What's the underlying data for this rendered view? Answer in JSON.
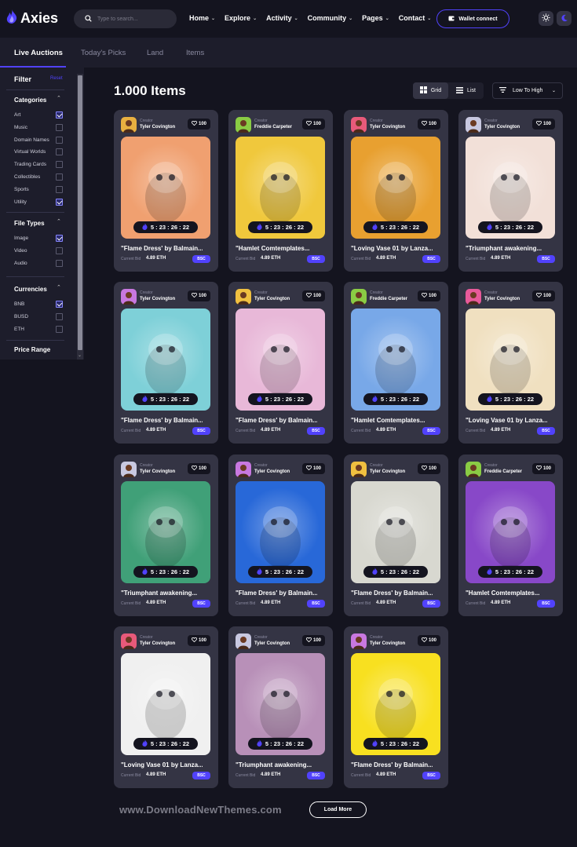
{
  "header": {
    "logo_text": "Axies",
    "search_placeholder": "Type to search...",
    "nav": [
      {
        "label": "Home"
      },
      {
        "label": "Explore"
      },
      {
        "label": "Activity"
      },
      {
        "label": "Community"
      },
      {
        "label": "Pages"
      },
      {
        "label": "Contact"
      }
    ],
    "wallet_label": "Wallet connect"
  },
  "tabs": [
    "Live Auctions",
    "Today's Picks",
    "Land",
    "Items"
  ],
  "sidebar": {
    "filter_title": "Filter",
    "reset_label": "Reset",
    "categories": {
      "title": "Categories",
      "options": [
        {
          "label": "Art",
          "checked": true
        },
        {
          "label": "Music",
          "checked": false
        },
        {
          "label": "Domain Names",
          "checked": false
        },
        {
          "label": "Virtual Worlds",
          "checked": false
        },
        {
          "label": "Trading Cards",
          "checked": false
        },
        {
          "label": "Collectibles",
          "checked": false
        },
        {
          "label": "Sports",
          "checked": false
        },
        {
          "label": "Utility",
          "checked": true
        }
      ]
    },
    "file_types": {
      "title": "File Types",
      "options": [
        {
          "label": "Image",
          "checked": true
        },
        {
          "label": "Video",
          "checked": false
        },
        {
          "label": "Audio",
          "checked": false
        }
      ]
    },
    "currencies": {
      "title": "Currencies",
      "options": [
        {
          "label": "BNB",
          "checked": true
        },
        {
          "label": "BUSD",
          "checked": false
        },
        {
          "label": "ETH",
          "checked": false
        }
      ]
    },
    "price_range_title": "Price Range"
  },
  "main": {
    "items_count": "1.000 Items",
    "view_grid": "Grid",
    "view_list": "List",
    "sort_label": "Low To High"
  },
  "card_common": {
    "creator_label": "Creator",
    "bid_label": "Current Bid",
    "bid_value": "4.89 ETH",
    "chain": "BSC",
    "likes": "100",
    "timer": "5 : 23 : 26 : 22"
  },
  "cards": [
    {
      "creator": "Tyler Covington",
      "title": "\"Flame Dress' by Balmain...",
      "bg": "#f0a070",
      "avatar_bg": "#e8b040"
    },
    {
      "creator": "Freddie Carpeter",
      "title": "\"Hamlet Comtemplates...",
      "bg": "#f0c83c",
      "avatar_bg": "#8acc44"
    },
    {
      "creator": "Tyler Covington",
      "title": "\"Loving Vase 01 by Lanza...",
      "bg": "#e8a030",
      "avatar_bg": "#e85a7a"
    },
    {
      "creator": "Tyler Covington",
      "title": "\"Triumphant awakening...",
      "bg": "#f2e0d8",
      "avatar_bg": "#c8c8e0"
    },
    {
      "creator": "Tyler Covington",
      "title": "\"Flame Dress' by Balmain...",
      "bg": "#7ed0d8",
      "avatar_bg": "#c878e0"
    },
    {
      "creator": "Tyler Covington",
      "title": "\"Flame Dress' by Balmain...",
      "bg": "#e8b8d8",
      "avatar_bg": "#f0c040"
    },
    {
      "creator": "Freddie Carpeter",
      "title": "\"Hamlet Comtemplates...",
      "bg": "#78a8e8",
      "avatar_bg": "#8acc44"
    },
    {
      "creator": "Tyler Covington",
      "title": "\"Loving Vase 01 by Lanza...",
      "bg": "#f0e0c0",
      "avatar_bg": "#e85a9a"
    },
    {
      "creator": "Tyler Covington",
      "title": "\"Triumphant awakening...",
      "bg": "#40a078",
      "avatar_bg": "#c8c8e0"
    },
    {
      "creator": "Tyler Covington",
      "title": "\"Flame Dress' by Balmain...",
      "bg": "#2868d8",
      "avatar_bg": "#c878e0"
    },
    {
      "creator": "Tyler Covington",
      "title": "\"Flame Dress' by Balmain...",
      "bg": "#d8d8d0",
      "avatar_bg": "#f0c040"
    },
    {
      "creator": "Freddie Carpeter",
      "title": "\"Hamlet Comtemplates...",
      "bg": "#8848c8",
      "avatar_bg": "#8acc44"
    },
    {
      "creator": "Tyler Covington",
      "title": "\"Loving Vase 01 by Lanza...",
      "bg": "#f0f0f0",
      "avatar_bg": "#e85a7a"
    },
    {
      "creator": "Tyler Covington",
      "title": "\"Triumphant awakening...",
      "bg": "#b890b8",
      "avatar_bg": "#c8c8e0"
    },
    {
      "creator": "Tyler Covington",
      "title": "\"Flame Dress' by Balmain...",
      "bg": "#f8e020",
      "avatar_bg": "#c878e0"
    }
  ],
  "footer": {
    "watermark": "www.DownloadNewThemes.com",
    "load_more": "Load More"
  }
}
